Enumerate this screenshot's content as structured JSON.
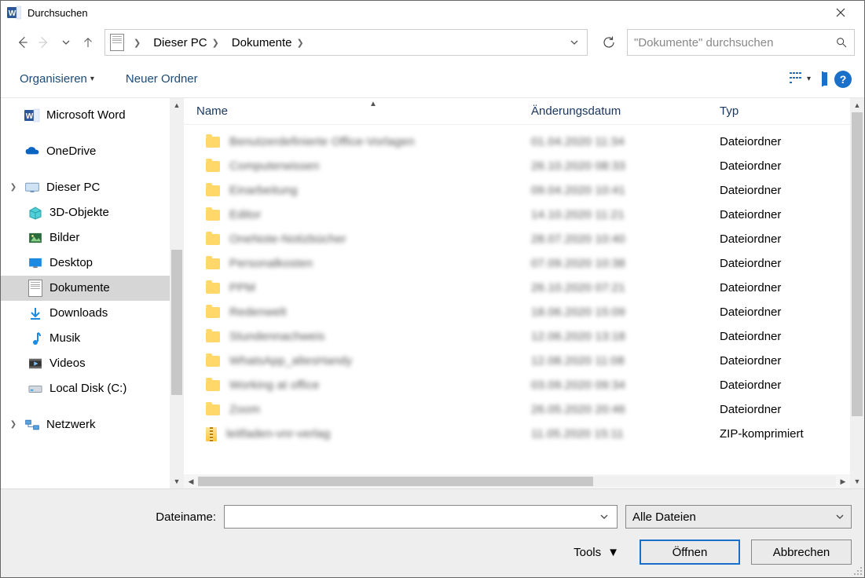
{
  "title": "Durchsuchen",
  "breadcrumbs": [
    "Dieser PC",
    "Dokumente"
  ],
  "search": {
    "placeholder": "\"Dokumente\" durchsuchen"
  },
  "toolbar": {
    "organize": "Organisieren",
    "new_folder": "Neuer Ordner"
  },
  "columns": {
    "name": "Name",
    "modified": "Änderungsdatum",
    "type": "Typ"
  },
  "sidebar": {
    "items": [
      {
        "label": "Microsoft Word",
        "kind": "word"
      },
      {
        "label": "OneDrive",
        "kind": "onedrive"
      },
      {
        "label": "Dieser PC",
        "kind": "pc",
        "expandable": true
      },
      {
        "label": "3D-Objekte",
        "kind": "3d",
        "child": true
      },
      {
        "label": "Bilder",
        "kind": "pictures",
        "child": true
      },
      {
        "label": "Desktop",
        "kind": "desktop",
        "child": true
      },
      {
        "label": "Dokumente",
        "kind": "documents",
        "child": true,
        "selected": true
      },
      {
        "label": "Downloads",
        "kind": "downloads",
        "child": true
      },
      {
        "label": "Musik",
        "kind": "music",
        "child": true
      },
      {
        "label": "Videos",
        "kind": "videos",
        "child": true
      },
      {
        "label": "Local Disk (C:)",
        "kind": "disk",
        "child": true
      },
      {
        "label": "Netzwerk",
        "kind": "network",
        "expandable": true
      }
    ]
  },
  "rows": [
    {
      "name": "Benutzerdefinierte Office-Vorlagen",
      "date": "01.04.2020 11:34",
      "type": "Dateiordner",
      "icon": "folder"
    },
    {
      "name": "Computerwissen",
      "date": "26.10.2020 08:33",
      "type": "Dateiordner",
      "icon": "folder"
    },
    {
      "name": "Einarbeitung",
      "date": "09.04.2020 10:41",
      "type": "Dateiordner",
      "icon": "folder"
    },
    {
      "name": "Editor",
      "date": "14.10.2020 11:21",
      "type": "Dateiordner",
      "icon": "folder"
    },
    {
      "name": "OneNote-Notizbücher",
      "date": "28.07.2020 10:40",
      "type": "Dateiordner",
      "icon": "folder"
    },
    {
      "name": "Personalkosten",
      "date": "07.09.2020 10:38",
      "type": "Dateiordner",
      "icon": "folder"
    },
    {
      "name": "PPM",
      "date": "26.10.2020 07:21",
      "type": "Dateiordner",
      "icon": "folder"
    },
    {
      "name": "Redenwelt",
      "date": "18.06.2020 15:09",
      "type": "Dateiordner",
      "icon": "folder"
    },
    {
      "name": "Stundennachweis",
      "date": "12.06.2020 13:18",
      "type": "Dateiordner",
      "icon": "folder"
    },
    {
      "name": "WhatsApp_altesHandy",
      "date": "12.08.2020 11:08",
      "type": "Dateiordner",
      "icon": "folder"
    },
    {
      "name": "Working at office",
      "date": "03.09.2020 09:34",
      "type": "Dateiordner",
      "icon": "folder"
    },
    {
      "name": "Zoom",
      "date": "26.05.2020 20:46",
      "type": "Dateiordner",
      "icon": "folder"
    },
    {
      "name": "leitfaden-vnr-verlag",
      "date": "11.05.2020 15:11",
      "type": "ZIP-komprimiert",
      "icon": "zip"
    }
  ],
  "bottom": {
    "filename_label": "Dateiname:",
    "filename_value": "",
    "filter": "Alle Dateien",
    "tools": "Tools",
    "open": "Öffnen",
    "cancel": "Abbrechen"
  }
}
